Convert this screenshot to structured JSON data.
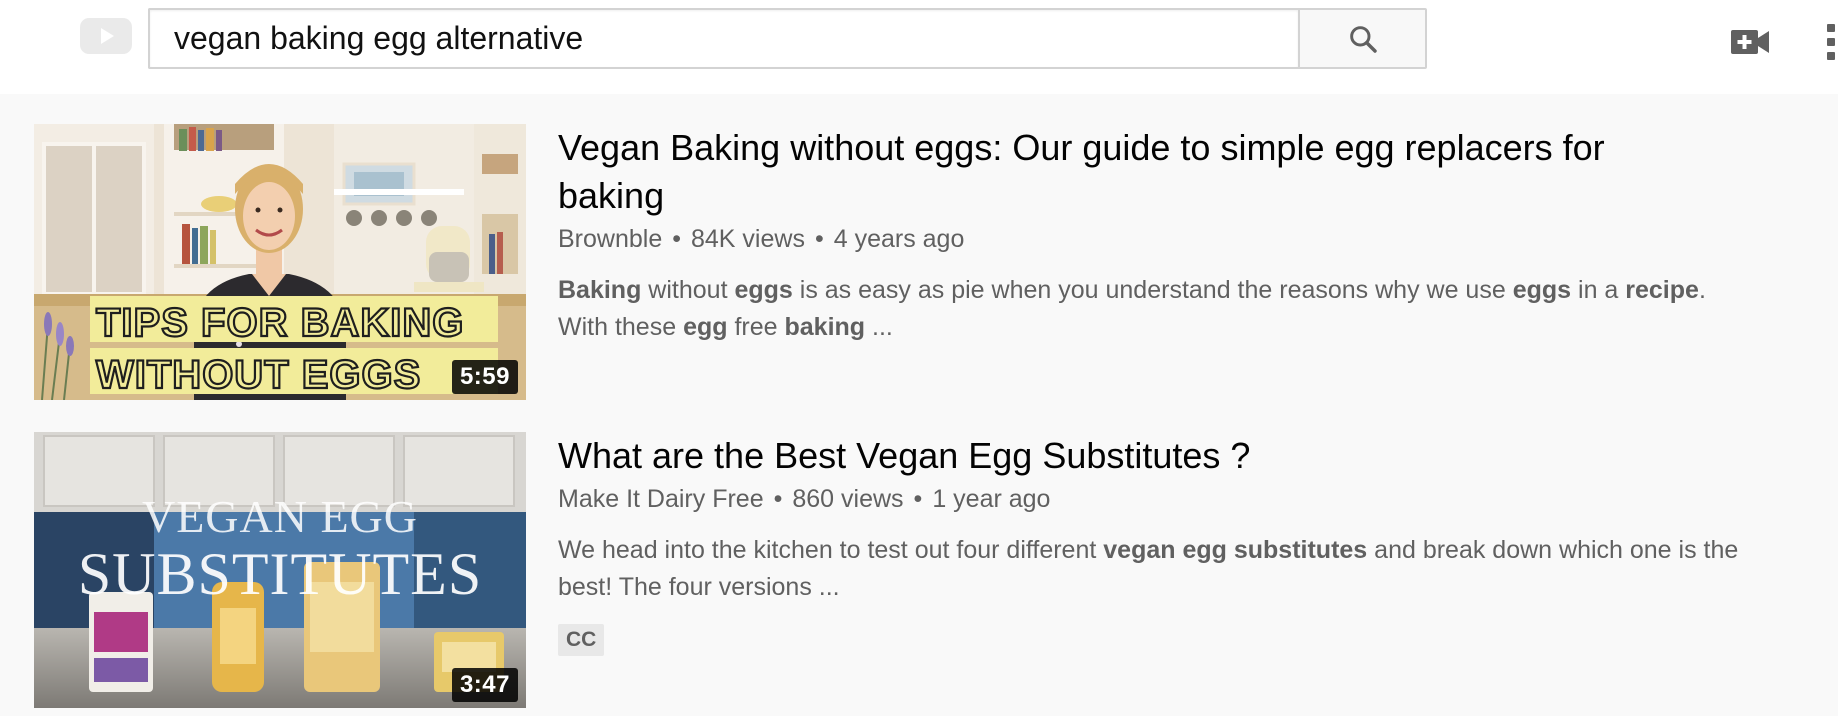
{
  "masthead": {
    "search_query": "vegan baking egg alternative",
    "icons": {
      "logo": "youtube-logo-icon",
      "search": "search-icon",
      "upload": "video-camera-plus-icon",
      "more": "more-vertical-icon"
    }
  },
  "results": [
    {
      "title": "Vegan Baking without eggs: Our guide to simple egg replacers for baking",
      "channel": "Brownble",
      "views": "84K views",
      "age": "4 years ago",
      "duration": "5:59",
      "thumbnail_text_line1": "TIPS FOR BAKING",
      "thumbnail_text_line2": "WITHOUT EGGS",
      "description": {
        "p1": "Baking",
        "p2": " without ",
        "p3": "eggs",
        "p4": " is as easy as pie when you understand the reasons why we use ",
        "p5": "eggs",
        "p6": " in a ",
        "p7": "recipe",
        "p8": ". With these ",
        "p9": "egg",
        "p10": " free ",
        "p11": "baking",
        "p12": " ..."
      }
    },
    {
      "title": "What are the Best Vegan Egg Substitutes ?",
      "channel": "Make It Dairy Free",
      "views": "860 views",
      "age": "1 year ago",
      "duration": "3:47",
      "thumbnail_text_line1": "VEGAN EGG",
      "thumbnail_text_line2": "SUBSTITUTES",
      "description": {
        "p1": "We head into the kitchen to test out four different ",
        "p2": "vegan egg substitutes",
        "p3": " and break down which one is the best! The four versions ..."
      },
      "badge": "CC"
    }
  ],
  "separator": "•",
  "colors": {
    "masthead_bg": "#ffffff",
    "page_bg": "#f9f9f9",
    "title_text": "#030303",
    "meta_text": "#606060",
    "thumb1_highlight": "#f2ec9a",
    "thumb2_backdrop": "#3f6e9c"
  }
}
